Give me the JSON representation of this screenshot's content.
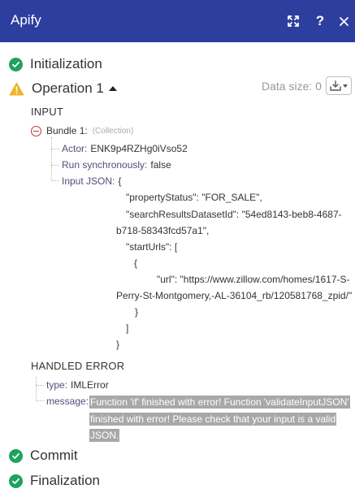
{
  "window": {
    "title": "Apify",
    "expand_icon": "expand-icon",
    "help_label": "?",
    "close_icon": "close-icon"
  },
  "steps": {
    "initialization": "Initialization",
    "operation": "Operation 1",
    "commit": "Commit",
    "finalization": "Finalization"
  },
  "data_size": "Data size: 0",
  "input": {
    "title": "INPUT",
    "bundle_name": "Bundle 1:",
    "bundle_type": "(Collection)",
    "actor_key": "Actor:",
    "actor_value": "ENK9p4RZHg0iVso52",
    "sync_key": "Run synchronously:",
    "sync_value": "false",
    "json_key": "Input JSON:",
    "json_lines": [
      "{",
      "\"propertyStatus\": \"FOR_SALE\",",
      "\"searchResultsDatasetId\": \"54ed8143-beb8-4687-",
      "b718-58343fcd57a1\",",
      "\"startUrls\": [",
      "{",
      "\"url\": \"https://www.zillow.com/homes/1617-S-",
      "Perry-St-Montgomery,-AL-36104_rb/120581768_zpid/\"",
      "}",
      "]",
      "}"
    ]
  },
  "handled_error": {
    "title": "HANDLED ERROR",
    "type_key": "type:",
    "type_value": "IMLError",
    "message_key": "message:",
    "message_value": "Function 'if' finished with error! Function 'validateInputJSON' finished with error! Please check that your input is a valid JSON."
  },
  "colors": {
    "titlebar": "#2c3e9e",
    "success": "#1fa35c",
    "warning": "#f0b429",
    "error": "#c0392b"
  }
}
